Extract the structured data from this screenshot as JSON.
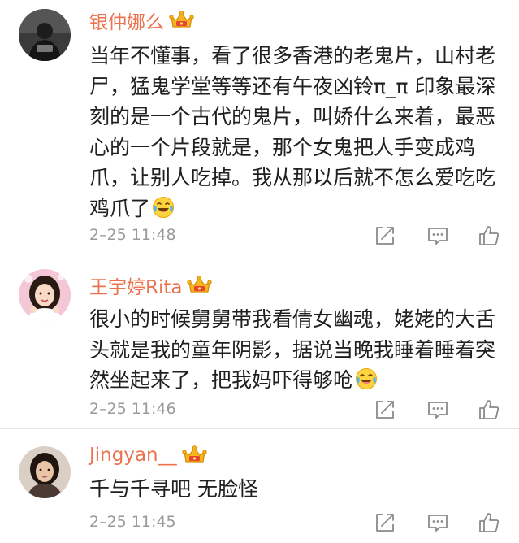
{
  "comments": [
    {
      "username": "银仲娜么",
      "text": "当年不懂事，看了很多香港的老鬼片，山村老尸，猛鬼学堂等等还有午夜凶铃π_π 印象最深刻的是一个古代的鬼片，叫娇什么来着，最恶心的一个片段就是，那个女鬼把人手变成鸡爪，让别人吃掉。我从那以后就不怎么爱吃吃鸡爪了",
      "emoji": "laugh-cry-emoji",
      "time": "2–25 11:48",
      "avatar": "avatar-dark-figure"
    },
    {
      "username": "王宇婷Rita",
      "text": "很小的时候舅舅带我看倩女幽魂，姥姥的大舌头就是我的童年阴影，据说当晚我睡着睡着突然坐起来了，把我妈吓得够呛",
      "emoji": "laugh-cry-emoji",
      "time": "2–25 11:46",
      "avatar": "avatar-girl-pink"
    },
    {
      "username": "Jingyan__",
      "text": "千与千寻吧 无脸怪",
      "time": "2–25 11:45",
      "avatar": "avatar-girl-portrait"
    }
  ],
  "icons": {
    "badge": "crown-badge-icon",
    "forward": "forward-icon",
    "comment": "comment-icon",
    "like": "like-icon"
  },
  "colors": {
    "username": "#eb7350",
    "text": "#202020",
    "meta": "#9a9a9a",
    "icon": "#8a8a8a",
    "divider": "#e6e6e6"
  }
}
